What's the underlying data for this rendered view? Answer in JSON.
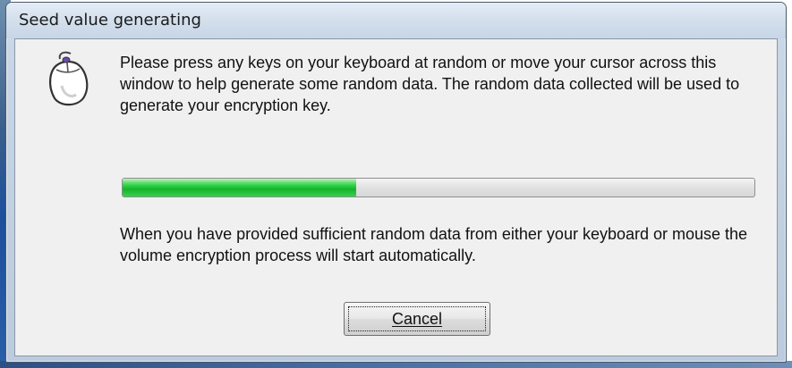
{
  "window": {
    "title": "Seed value generating"
  },
  "dialog": {
    "icon": "mouse-icon",
    "message": "Please press any keys on your keyboard at random or move your cursor across this window to help generate some random data. The random data collected will be used to generate your encryption key.",
    "progress_fraction": 0.37,
    "progress_color": "#22c43a",
    "info": "When you have provided sufficient random data from either your keyboard or mouse the volume encryption process will start automatically.",
    "cancel_label": "Cancel"
  }
}
